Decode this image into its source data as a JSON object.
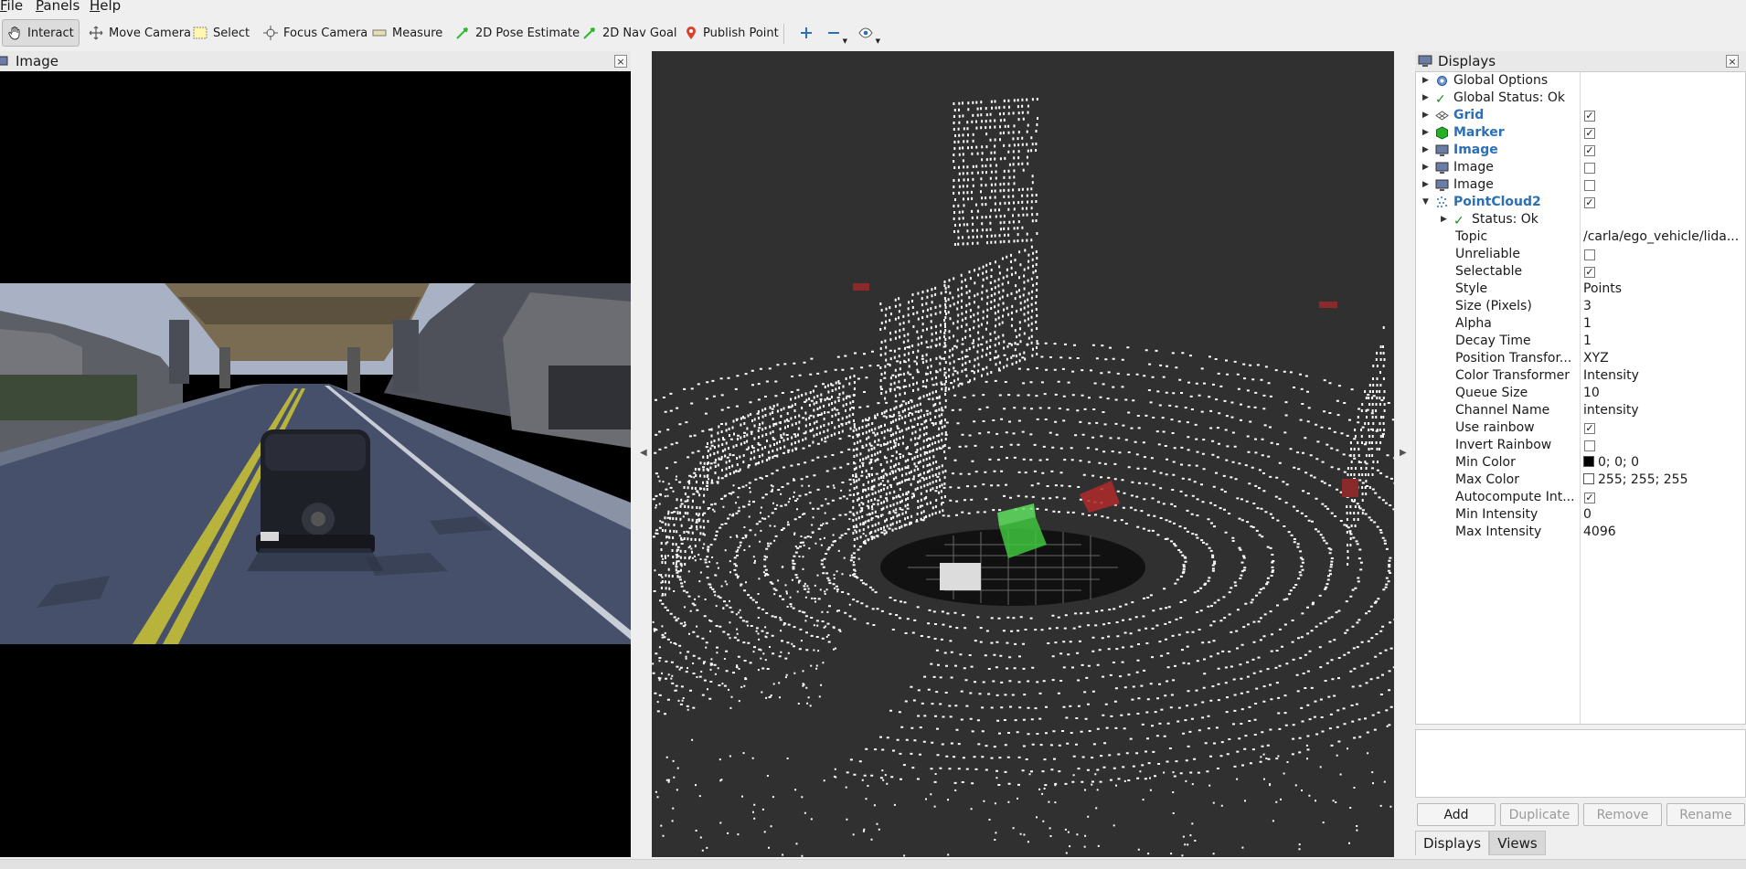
{
  "menu": {
    "file": "File",
    "panels": "Panels",
    "help": "Help"
  },
  "toolbar": {
    "interact": "Interact",
    "move_camera": "Move Camera",
    "select": "Select",
    "focus_camera": "Focus Camera",
    "measure": "Measure",
    "pose_estimate": "2D Pose Estimate",
    "nav_goal": "2D Nav Goal",
    "publish_point": "Publish Point"
  },
  "image_panel": {
    "title": "Image"
  },
  "displays_panel": {
    "title": "Displays",
    "rows": [
      {
        "label": "Global Options"
      },
      {
        "label": "Global Status: Ok"
      },
      {
        "label": "Grid",
        "checked": true
      },
      {
        "label": "Marker",
        "checked": true
      },
      {
        "label": "Image",
        "checked": true
      },
      {
        "label": "Image",
        "checked": false
      },
      {
        "label": "Image",
        "checked": false
      },
      {
        "label": "PointCloud2",
        "checked": true
      },
      {
        "label": "Status: Ok"
      },
      {
        "label": "Topic",
        "value": "/carla/ego_vehicle/lida..."
      },
      {
        "label": "Unreliable",
        "checked": false
      },
      {
        "label": "Selectable",
        "checked": true
      },
      {
        "label": "Style",
        "value": "Points"
      },
      {
        "label": "Size (Pixels)",
        "value": "3"
      },
      {
        "label": "Alpha",
        "value": "1"
      },
      {
        "label": "Decay Time",
        "value": "1"
      },
      {
        "label": "Position Transfor...",
        "value": "XYZ"
      },
      {
        "label": "Color Transformer",
        "value": "Intensity"
      },
      {
        "label": "Queue Size",
        "value": "10"
      },
      {
        "label": "Channel Name",
        "value": "intensity"
      },
      {
        "label": "Use rainbow",
        "checked": true
      },
      {
        "label": "Invert Rainbow",
        "checked": false
      },
      {
        "label": "Min Color",
        "value": "0; 0; 0",
        "color": "#000000"
      },
      {
        "label": "Max Color",
        "value": "255; 255; 255",
        "color": "#ffffff"
      },
      {
        "label": "Autocompute Int...",
        "checked": true
      },
      {
        "label": "Min Intensity",
        "value": "0"
      },
      {
        "label": "Max Intensity",
        "value": "4096"
      }
    ]
  },
  "buttons": {
    "add": "Add",
    "duplicate": "Duplicate",
    "remove": "Remove",
    "rename": "Rename"
  },
  "tabs": {
    "displays": "Displays",
    "views": "Views"
  },
  "colors": {
    "accent_blue": "#2a6fb8",
    "viewport_bg": "#303030",
    "marker_green": "#3ec43e",
    "marker_red": "#b02a2a"
  }
}
